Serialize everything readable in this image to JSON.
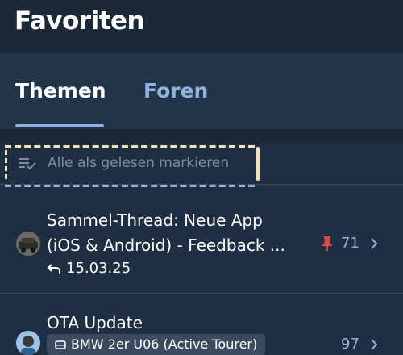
{
  "header": {
    "title": "Favoriten"
  },
  "tabs": [
    {
      "label": "Themen",
      "selected": true
    },
    {
      "label": "Foren",
      "selected": false
    }
  ],
  "mark_all_read": {
    "label": "Alle als gelesen markieren",
    "icon": "mark-read-icon"
  },
  "threads": [
    {
      "title_line1": "Sammel-Thread: Neue App",
      "title_line2": "(iOS & Android) - Feedback ...",
      "date": "15.03.25",
      "pinned": true,
      "count": "71",
      "avatar": "avatar-car-photo"
    },
    {
      "title_line1": "OTA Update",
      "forum": "BMW 2er U06 (Active Tourer)",
      "count": "97",
      "avatar": "avatar-person"
    }
  ],
  "colors": {
    "background": "#1e2e43",
    "header": "#1a2838",
    "tab_bar": "#223449",
    "accent": "#8fb3dd",
    "pin": "#e0463c",
    "muted": "#7d8ea3"
  }
}
